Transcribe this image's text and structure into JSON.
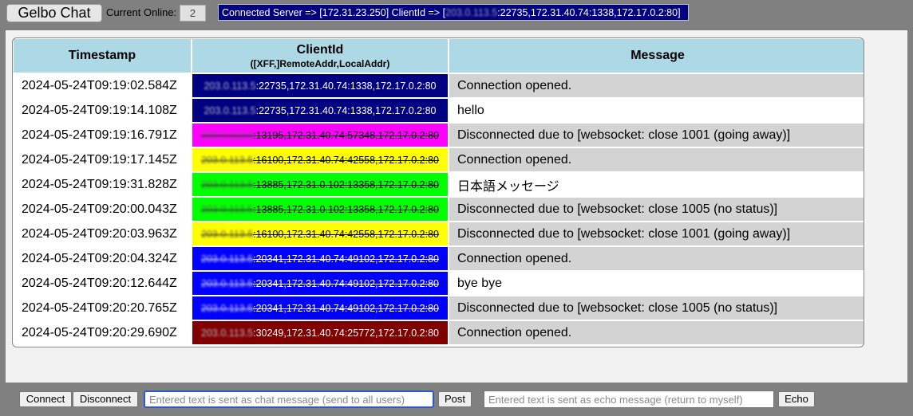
{
  "header": {
    "app_title": "Gelbo Chat",
    "online_label": "Current Online:",
    "online_count": "2",
    "server_prefix": "Connected Server => [172.31.23.250] ClientId => [",
    "server_redacted": "203.0.113.5",
    "server_suffix": ":22735,172.31.40.74:1338,172.17.0.2:80]"
  },
  "table": {
    "columns": {
      "timestamp": "Timestamp",
      "clientid": "ClientId",
      "clientid_sub": "([XFF,]RemoteAddr,LocalAddr)",
      "message": "Message"
    },
    "rows": [
      {
        "timestamp": "2024-05-24T09:19:02.584Z",
        "client_redacted": "203.0.113.5",
        "client_suffix": ":22735,172.31.40.74:1338,172.17.0.2:80",
        "client_bg": "#000080",
        "client_fg": "#ffffff",
        "disconnected": false,
        "message": "Connection opened.",
        "system": true
      },
      {
        "timestamp": "2024-05-24T09:19:14.108Z",
        "client_redacted": "203.0.113.5",
        "client_suffix": ":22735,172.31.40.74:1338,172.17.0.2:80",
        "client_bg": "#000080",
        "client_fg": "#ffffff",
        "disconnected": false,
        "message": "hello",
        "system": false
      },
      {
        "timestamp": "2024-05-24T09:19:16.791Z",
        "client_redacted": "203.0.113.5",
        "client_suffix": ":13195,172.31.40.74:57348,172.17.0.2:80",
        "client_bg": "#ff00ff",
        "client_fg": "#000000",
        "disconnected": true,
        "message": "Disconnected due to [websocket: close 1001 (going away)]",
        "system": true
      },
      {
        "timestamp": "2024-05-24T09:19:17.145Z",
        "client_redacted": "203.0.113.5",
        "client_suffix": ":16100,172.31.40.74:42558,172.17.0.2:80",
        "client_bg": "#ffff00",
        "client_fg": "#000000",
        "disconnected": true,
        "message": "Connection opened.",
        "system": true
      },
      {
        "timestamp": "2024-05-24T09:19:31.828Z",
        "client_redacted": "203.0.113.5",
        "client_suffix": ":13885,172.31.0.102:13358,172.17.0.2:80",
        "client_bg": "#00ff00",
        "client_fg": "#000000",
        "disconnected": true,
        "message": "日本語メッセージ",
        "system": false
      },
      {
        "timestamp": "2024-05-24T09:20:00.043Z",
        "client_redacted": "203.0.113.5",
        "client_suffix": ":13885,172.31.0.102:13358,172.17.0.2:80",
        "client_bg": "#00ff00",
        "client_fg": "#000000",
        "disconnected": true,
        "message": "Disconnected due to [websocket: close 1005 (no status)]",
        "system": true
      },
      {
        "timestamp": "2024-05-24T09:20:03.963Z",
        "client_redacted": "203.0.113.5",
        "client_suffix": ":16100,172.31.40.74:42558,172.17.0.2:80",
        "client_bg": "#ffff00",
        "client_fg": "#000000",
        "disconnected": true,
        "message": "Disconnected due to [websocket: close 1001 (going away)]",
        "system": true
      },
      {
        "timestamp": "2024-05-24T09:20:04.324Z",
        "client_redacted": "203.0.113.5",
        "client_suffix": ":20341,172.31.40.74:49102,172.17.0.2:80",
        "client_bg": "#0000ff",
        "client_fg": "#ffffff",
        "disconnected": true,
        "message": "Connection opened.",
        "system": true
      },
      {
        "timestamp": "2024-05-24T09:20:12.644Z",
        "client_redacted": "203.0.113.5",
        "client_suffix": ":20341,172.31.40.74:49102,172.17.0.2:80",
        "client_bg": "#0000ff",
        "client_fg": "#ffffff",
        "disconnected": true,
        "message": "bye bye",
        "system": false
      },
      {
        "timestamp": "2024-05-24T09:20:20.765Z",
        "client_redacted": "203.0.113.5",
        "client_suffix": ":20341,172.31.40.74:49102,172.17.0.2:80",
        "client_bg": "#0000ff",
        "client_fg": "#ffffff",
        "disconnected": true,
        "message": "Disconnected due to [websocket: close 1005 (no status)]",
        "system": true
      },
      {
        "timestamp": "2024-05-24T09:20:29.690Z",
        "client_redacted": "203.0.113.5",
        "client_suffix": ":30249,172.31.40.74:25772,172.17.0.2:80",
        "client_bg": "#800000",
        "client_fg": "#ffffff",
        "disconnected": false,
        "message": "Connection opened.",
        "system": true
      }
    ]
  },
  "controls": {
    "connect_label": "Connect",
    "disconnect_label": "Disconnect",
    "chat_placeholder": "Entered text is sent as chat message (send to all users)",
    "chat_value": "",
    "post_label": "Post",
    "echo_placeholder": "Entered text is sent as echo message (return to myself)",
    "echo_value": "",
    "echo_label": "Echo"
  }
}
